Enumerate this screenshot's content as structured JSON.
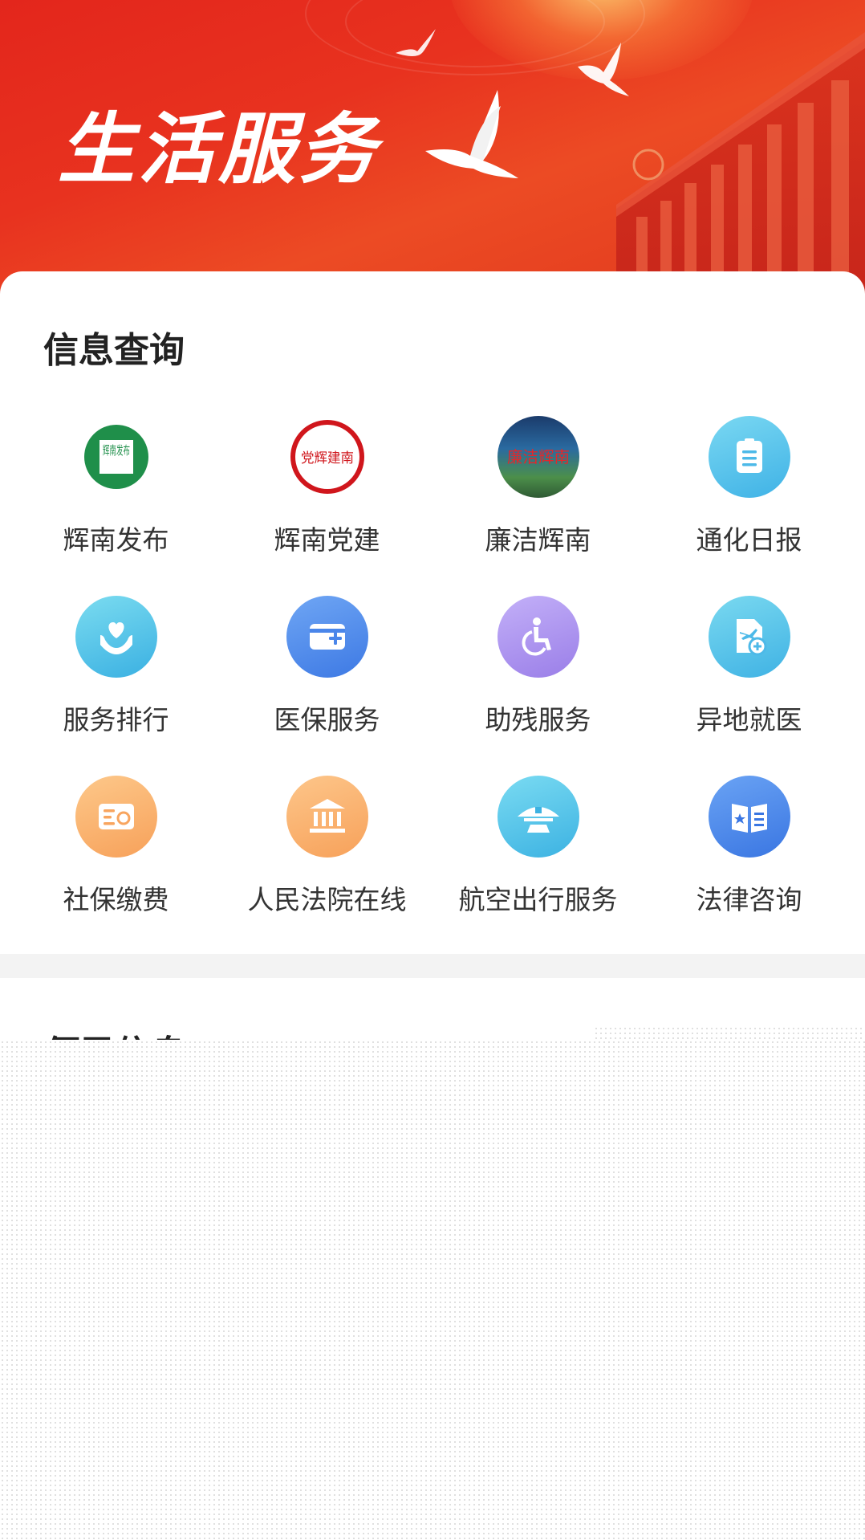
{
  "banner": {
    "title": "生活服务"
  },
  "section_info": {
    "title": "信息查询",
    "items": [
      {
        "label": "辉南发布",
        "icon": "huinan-release-seal-icon",
        "glyphs": "辉南发布"
      },
      {
        "label": "辉南党建",
        "icon": "huinan-party-building-seal-icon",
        "glyphs": "党辉建南"
      },
      {
        "label": "廉洁辉南",
        "icon": "clean-huinan-icon",
        "glyphs": "廉洁辉南"
      },
      {
        "label": "通化日报",
        "icon": "clipboard-icon"
      },
      {
        "label": "服务排行",
        "icon": "heart-hands-icon"
      },
      {
        "label": "医保服务",
        "icon": "wallet-plus-icon"
      },
      {
        "label": "助残服务",
        "icon": "wheelchair-icon"
      },
      {
        "label": "异地就医",
        "icon": "plane-medical-doc-icon"
      },
      {
        "label": "社保缴费",
        "icon": "id-card-icon"
      },
      {
        "label": "人民法院在线",
        "icon": "courthouse-icon"
      },
      {
        "label": "航空出行服务",
        "icon": "airport-icon"
      },
      {
        "label": "法律咨询",
        "icon": "law-book-icon"
      }
    ]
  },
  "section_next": {
    "title": "便民信息"
  },
  "colors": {
    "banner_red": "#e3261c",
    "green_seal": "#1f8f4a",
    "red_seal": "#d0161c",
    "light_blue": "#52c1ea",
    "blue": "#4a86ea",
    "purple": "#a98df0",
    "orange": "#fab06a"
  }
}
